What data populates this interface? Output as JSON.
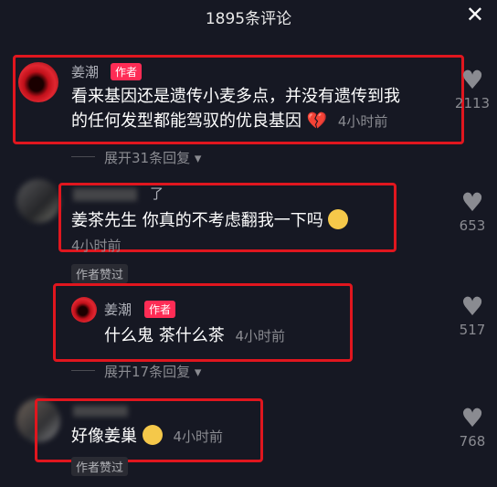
{
  "header": {
    "title": "1895条评论",
    "close_icon": "close-icon"
  },
  "comments": [
    {
      "name": "姜潮",
      "badge": "作者",
      "text_line1": "看来基因还是遗传小麦多点，并没有遗传到我",
      "text_line2": "的任何发型都能驾驭的优良基因",
      "emoji": "broken-heart-emoji",
      "time": "4小时前",
      "likes": "2113",
      "expand": "展开31条回复"
    },
    {
      "name": "了",
      "text": "姜茶先生 你真的不考虑翻我一下吗",
      "emoji": "pleading-face-emoji",
      "time": "4小时前",
      "likes": "653",
      "liked_by_author": "作者赞过"
    },
    {
      "name": "姜潮",
      "badge": "作者",
      "text": "什么鬼 茶什么茶",
      "time": "4小时前",
      "likes": "517",
      "expand": "展开17条回复"
    },
    {
      "text": "好像姜巢",
      "emoji": "surprised-face-emoji",
      "time": "4小时前",
      "likes": "768",
      "liked_by_author": "作者赞过"
    }
  ],
  "colors": {
    "background": "#161823",
    "highlight_box": "#e0161e",
    "author_badge": "#fe2c55"
  }
}
